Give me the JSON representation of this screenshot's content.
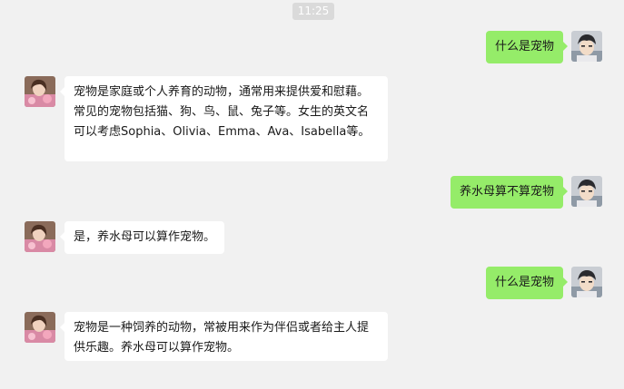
{
  "chat": {
    "timestamp": "11:25",
    "messages": [
      {
        "sender": "self",
        "text": "什么是宠物"
      },
      {
        "sender": "other",
        "text": "宠物是家庭或个人养育的动物，通常用来提供爱和慰藉。常见的宠物包括猫、狗、鸟、鼠、兔子等。女生的英文名可以考虑Sophia、Olivia、Emma、Ava、Isabella等。"
      },
      {
        "sender": "self",
        "text": "养水母算不算宠物"
      },
      {
        "sender": "other",
        "text": "是，养水母可以算作宠物。"
      },
      {
        "sender": "self",
        "text": "什么是宠物"
      },
      {
        "sender": "other",
        "text": "宠物是一种饲养的动物，常被用来作为伴侣或者给主人提供乐趣。养水母可以算作宠物。"
      }
    ]
  },
  "colors": {
    "background": "#f1f1f1",
    "self_bubble": "#95ec69",
    "other_bubble": "#ffffff",
    "timestamp_bg": "#dadada"
  },
  "icons": {
    "self_avatar": "user-avatar-icon",
    "other_avatar": "bot-avatar-icon"
  }
}
